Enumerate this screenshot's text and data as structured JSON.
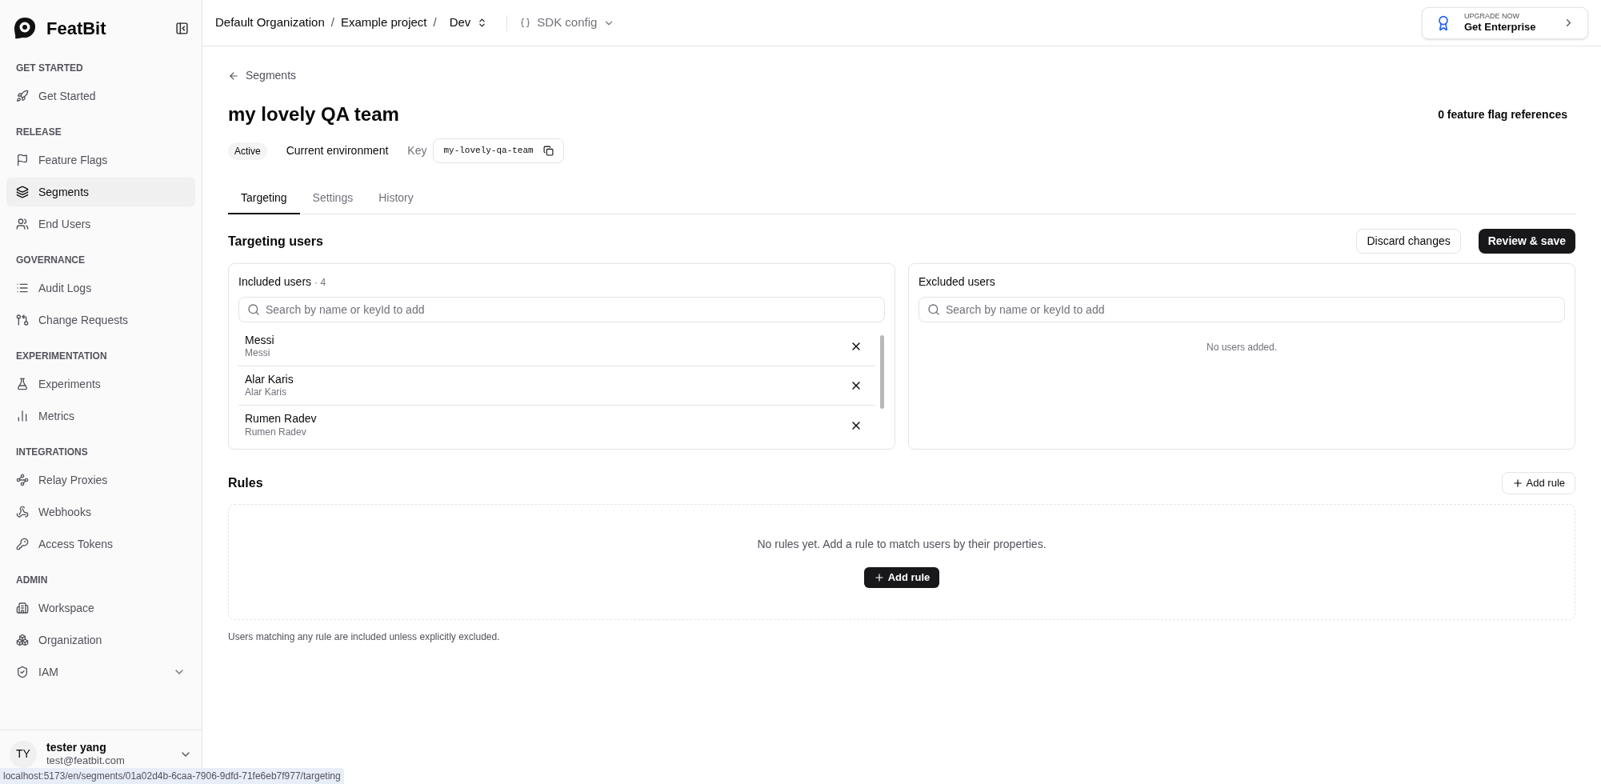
{
  "brand": "FeatBit",
  "sidebar": {
    "sections": [
      {
        "title": "GET STARTED",
        "items": [
          {
            "label": "Get Started",
            "selected": false
          }
        ]
      },
      {
        "title": "RELEASE",
        "items": [
          {
            "label": "Feature Flags",
            "selected": false
          },
          {
            "label": "Segments",
            "selected": true
          },
          {
            "label": "End Users",
            "selected": false
          }
        ]
      },
      {
        "title": "GOVERNANCE",
        "items": [
          {
            "label": "Audit Logs",
            "selected": false
          },
          {
            "label": "Change Requests",
            "selected": false
          }
        ]
      },
      {
        "title": "EXPERIMENTATION",
        "items": [
          {
            "label": "Experiments",
            "selected": false
          },
          {
            "label": "Metrics",
            "selected": false
          }
        ]
      },
      {
        "title": "INTEGRATIONS",
        "items": [
          {
            "label": "Relay Proxies",
            "selected": false
          },
          {
            "label": "Webhooks",
            "selected": false
          },
          {
            "label": "Access Tokens",
            "selected": false
          }
        ]
      },
      {
        "title": "ADMIN",
        "items": [
          {
            "label": "Workspace",
            "selected": false
          },
          {
            "label": "Organization",
            "selected": false
          },
          {
            "label": "IAM",
            "selected": false,
            "expandable": true
          }
        ]
      }
    ],
    "user": {
      "initials": "TY",
      "name": "tester yang",
      "email": "test@featbit.com"
    }
  },
  "breadcrumb": [
    {
      "label": "Default Organization",
      "separator": "/"
    },
    {
      "label": "Example project",
      "separator": "/"
    }
  ],
  "environment": "Dev",
  "sdk_config": "SDK config",
  "upgrade": {
    "caption": "UPGRADE NOW",
    "label": "Get Enterprise"
  },
  "back_link": "Segments",
  "title": "my lovely QA team",
  "references": "0 feature flag references",
  "status": "Active",
  "environment_label": "Current environment",
  "key_label": "Key",
  "key": "my-lovely-qa-team",
  "tabs": [
    {
      "label": "Targeting",
      "selected": true
    },
    {
      "label": "Settings",
      "selected": false
    },
    {
      "label": "History",
      "selected": false
    }
  ],
  "targeting": {
    "title": "Targeting users",
    "buttons": [
      "Discard changes",
      "Review & save"
    ],
    "included": {
      "title": "Included users",
      "count": "· 4",
      "placeholder": "Search by name or keyId to add",
      "users": [
        {
          "name": "Messi",
          "key": "Messi"
        },
        {
          "name": "Alar Karis",
          "key": "Alar Karis"
        },
        {
          "name": "Rumen Radev",
          "key": "Rumen Radev"
        }
      ]
    },
    "excluded": {
      "title": "Excluded users",
      "placeholder": "Search by name or keyId to add",
      "empty": "No users added."
    }
  },
  "rules": {
    "title": "Rules",
    "add_button": "Add rule",
    "empty": "No rules yet. Add a rule to match users by their properties.",
    "empty_button": "Add rule",
    "note": "Users matching any rule are included unless explicitly excluded."
  },
  "status_bar": "localhost:5173/en/segments/01a02d4b-6caa-7906-9dfd-71fe6eb7f977/targeting"
}
